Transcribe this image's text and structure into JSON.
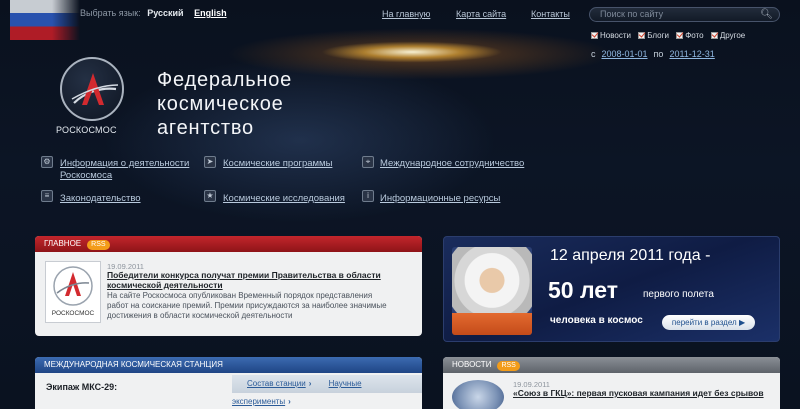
{
  "language": {
    "label": "Выбрать язык:",
    "current": "Русский",
    "other": "English"
  },
  "top_links": {
    "home": "На главную",
    "sitemap": "Карта сайта",
    "contacts": "Контакты"
  },
  "search": {
    "placeholder": "Поиск по сайту"
  },
  "filters": [
    "Новости",
    "Блоги",
    "Фото",
    "Другое"
  ],
  "dates": {
    "from_label": "с",
    "from": "2008-01-01",
    "to_label": "по",
    "to": "2011-12-31"
  },
  "logo": {
    "word": "РОСКОСМОС"
  },
  "agency": {
    "line1": "Федеральное",
    "line2": "космическое",
    "line3": "агентство"
  },
  "nav": {
    "activity1": "Информация о деятельности",
    "activity2": "Роскосмоса",
    "programs": "Космические программы",
    "cooperation": "Международное сотрудничество",
    "legislation": "Законодательство",
    "research": "Космические исследования",
    "resources": "Информационные ресурсы"
  },
  "main_news": {
    "header": "ГЛАВНОЕ",
    "rss": "RSS",
    "date": "19.09.2011",
    "title1": "Победители конкурса получат премии Правительства в области",
    "title2": "космической деятельности",
    "text1": "На сайте Роскосмоса опубликован Временный порядок представления",
    "text2": "работ на соискание премий. Премии присуждаются за наиболее значимые",
    "text3": "достижения в области космической деятельности",
    "thumb_word": "РОСКОСМОС"
  },
  "banner": {
    "date": "12 апреля 2011 года -",
    "years": "50 лет",
    "flight": "первого полета",
    "human": "человека в космос",
    "button": "перейти в раздел"
  },
  "iss": {
    "header": "МЕЖДУНАРОДНАЯ КОСМИЧЕСКАЯ СТАНЦИЯ",
    "crew": "Экипаж МКС-29:",
    "tab1": "Состав станции",
    "tab2": "Научные эксперименты"
  },
  "news": {
    "header": "НОВОСТИ",
    "rss": "RSS",
    "date": "19.09.2011",
    "title": "«Союз в ГКЦ»: первая пусковая кампания идет без срывов"
  }
}
